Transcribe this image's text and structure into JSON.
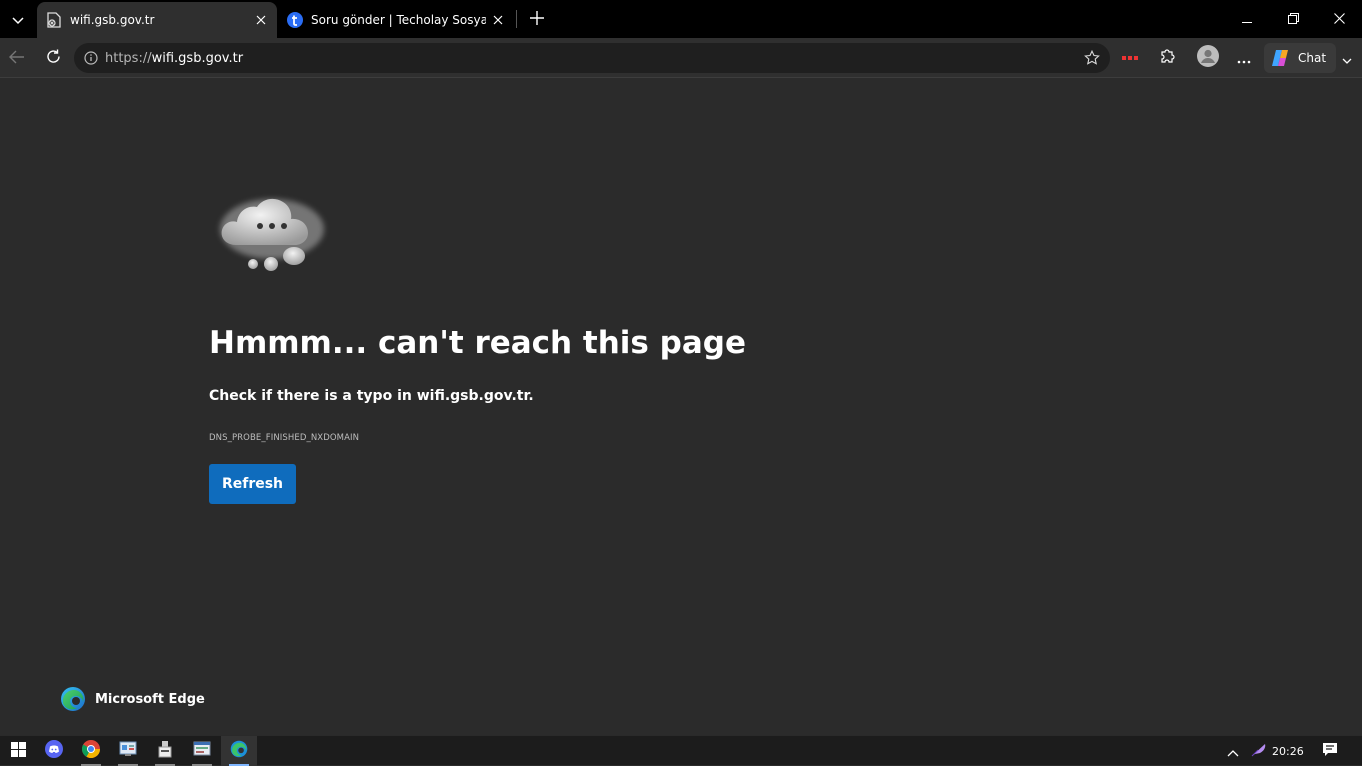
{
  "tabs": [
    {
      "title": "wifi.gsb.gov.tr",
      "active": true
    },
    {
      "title": "Soru gönder | Techolay Sosyal",
      "active": false
    }
  ],
  "toolbar": {
    "url_scheme": "https://",
    "url_host": "wifi.gsb.gov.tr",
    "chat_label": "Chat"
  },
  "page": {
    "headline": "Hmmm... can't reach this page",
    "subtext": "Check if there is a typo in wifi.gsb.gov.tr.",
    "error_code": "DNS_PROBE_FINISHED_NXDOMAIN",
    "refresh_label": "Refresh",
    "brand_name": "Microsoft Edge"
  },
  "taskbar": {
    "apps": [
      "windows-start",
      "discord",
      "chrome",
      "control-panel",
      "usb-device",
      "network-manager",
      "edge"
    ],
    "clock": "20:26"
  },
  "colors": {
    "page_bg": "#2b2b2b",
    "accent": "#0f6cbd",
    "tabstrip_bg": "#000000"
  }
}
